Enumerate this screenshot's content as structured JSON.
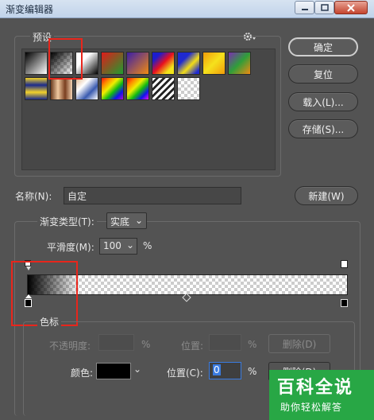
{
  "window": {
    "title": "渐变编辑器"
  },
  "presets": {
    "label": "预设"
  },
  "buttons": {
    "ok": "确定",
    "reset": "复位",
    "load": "载入(L)...",
    "save": "存储(S)...",
    "new": "新建(W)"
  },
  "name": {
    "label": "名称(N):",
    "value": "自定"
  },
  "gradient_type": {
    "label": "渐变类型(T):",
    "value": "实底"
  },
  "smoothness": {
    "label": "平滑度(M):",
    "value": "100",
    "unit": "%"
  },
  "stops": {
    "group_label": "色标",
    "opacity_label": "不透明度:",
    "opacity_unit": "%",
    "opacity_location_label": "位置:",
    "opacity_location_unit": "%",
    "opacity_delete": "删除(D)",
    "color_label": "颜色:",
    "color_value": "#000000",
    "color_location_label": "位置(C):",
    "color_location_value": "0",
    "color_location_unit": "%",
    "color_delete": "删除(D)"
  },
  "watermark": {
    "title": "百科全说",
    "subtitle": "助你轻松解答"
  }
}
